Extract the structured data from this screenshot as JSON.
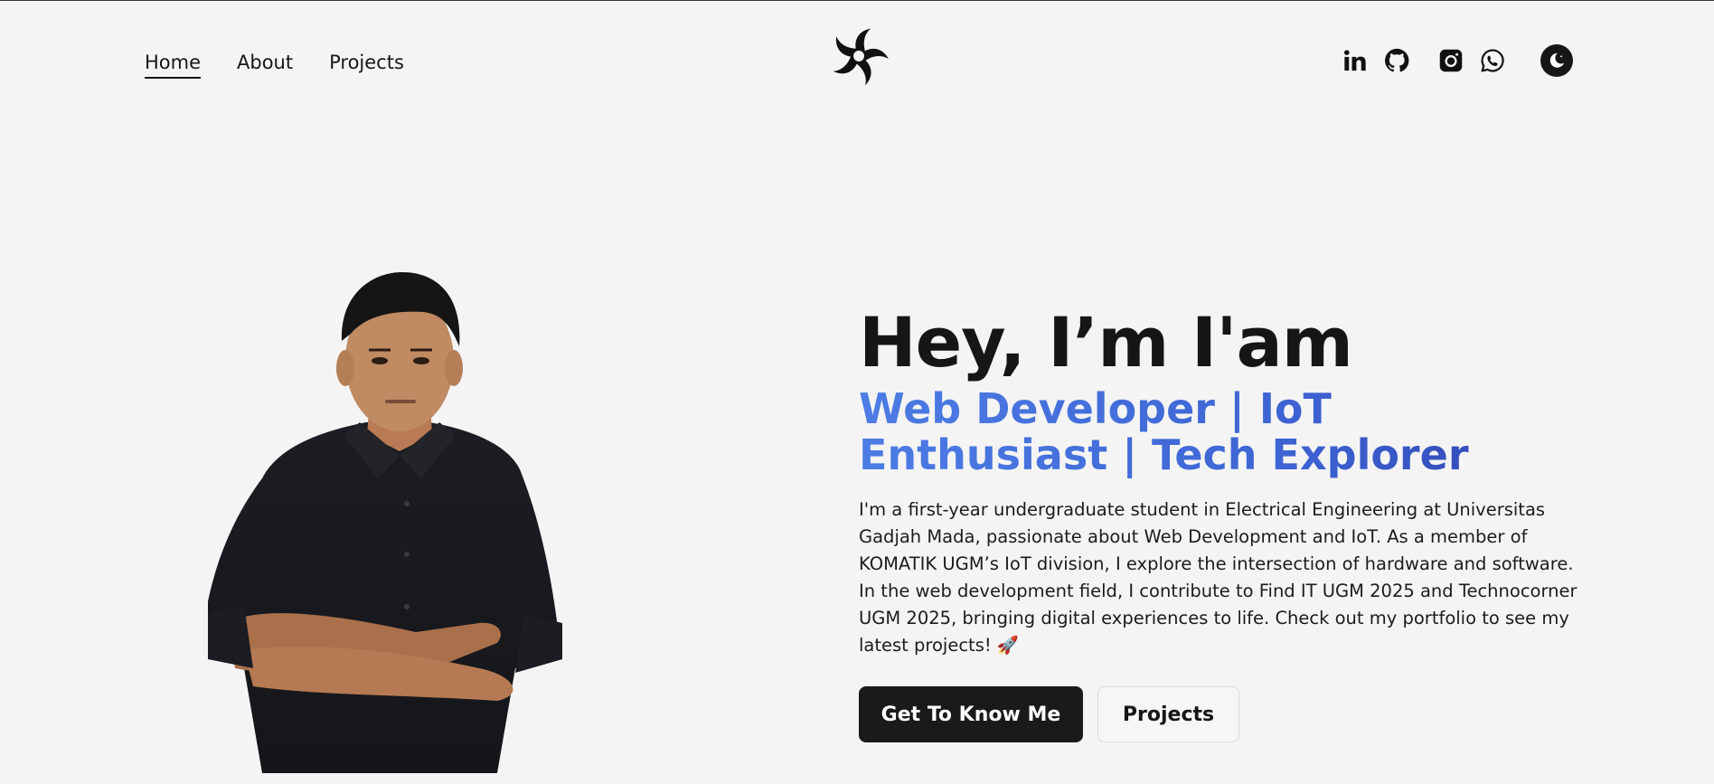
{
  "nav": {
    "items": [
      {
        "label": "Home",
        "active": true
      },
      {
        "label": "About",
        "active": false
      },
      {
        "label": "Projects",
        "active": false
      }
    ]
  },
  "logo": {
    "icon": "spiral-logo-icon"
  },
  "socials": {
    "items": [
      {
        "icon": "linkedin-icon"
      },
      {
        "icon": "github-icon"
      },
      {
        "icon": "instagram-icon"
      },
      {
        "icon": "whatsapp-icon"
      }
    ],
    "theme_toggle_icon": "moon-icon"
  },
  "hero": {
    "greeting": "Hey, I’m I'am",
    "roles": "Web Developer | IoT Enthusiast | Tech Explorer",
    "bio": "I'm a first-year undergraduate student in Electrical Engineering at Universitas Gadjah Mada, passionate about Web Development and IoT. As a member of KOMATIK UGM’s IoT division, I explore the intersection of hardware and software. In the web development field, I contribute to Find IT UGM 2025 and Technocorner UGM 2025, bringing digital experiences to life. Check out my portfolio to see my latest projects! 🚀",
    "primary_button": "Get To Know Me",
    "secondary_button": "Projects"
  },
  "colors": {
    "background": "#f4f4f4",
    "text": "#161616",
    "accent_gradient_start": "#4c7ce4",
    "accent_gradient_end": "#2f44b0"
  }
}
